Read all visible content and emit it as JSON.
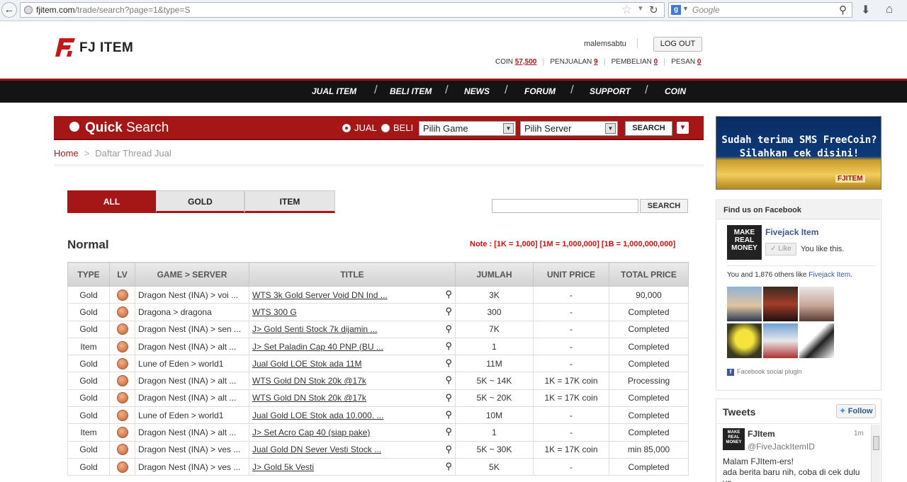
{
  "browser": {
    "url_domain": "fjitem.com",
    "url_path": "/trade/search?page=1&type=S",
    "search_placeholder": "Google"
  },
  "site": {
    "logo_text": "FJ ITEM",
    "username": "malemsabtu",
    "logout_label": "LOG OUT",
    "stats": {
      "coin_label": "COIN",
      "coin_value": "57,500",
      "penjualan_label": "PENJUALAN",
      "penjualan_value": "9",
      "pembelian_label": "PEMBELIAN",
      "pembelian_value": "0",
      "pesan_label": "PESAN",
      "pesan_value": "0"
    },
    "nav": [
      "JUAL ITEM",
      "BELI ITEM",
      "NEWS",
      "FORUM",
      "SUPPORT",
      "COIN"
    ]
  },
  "quick_search": {
    "title_bold": "Quick",
    "title_rest": " Search",
    "radio_jual": "JUAL",
    "radio_beli": "BELI",
    "selected_radio": "JUAL",
    "game_select": "Pilih Game",
    "server_select": "Pilih Server",
    "search_label": "SEARCH"
  },
  "breadcrumb": {
    "home": "Home",
    "separator": ">",
    "current": "Daftar Thread Jual"
  },
  "tabs": [
    {
      "label": "ALL",
      "active": true
    },
    {
      "label": "GOLD",
      "active": false
    },
    {
      "label": "ITEM",
      "active": false
    }
  ],
  "table_search": {
    "value": "",
    "button": "SEARCH"
  },
  "section_title": "Normal",
  "note": "Note : [1K = 1,000] [1M = 1,000,000] [1B = 1,000,000,000]",
  "table": {
    "headers": [
      "TYPE",
      "LV",
      "GAME > SERVER",
      "TITLE",
      "JUMLAH",
      "UNIT PRICE",
      "TOTAL PRICE"
    ],
    "rows": [
      {
        "type": "Gold",
        "game": "Dragon Nest (INA) > voi ...",
        "title": "WTS 3k Gold Server Void DN Ind ...",
        "jumlah": "3K",
        "unit": "-",
        "total": "90,000"
      },
      {
        "type": "Gold",
        "game": "Dragona > dragona",
        "title": "WTS 300 G",
        "jumlah": "300",
        "unit": "-",
        "total": "Completed"
      },
      {
        "type": "Gold",
        "game": "Dragon Nest (INA) > sen ...",
        "title": "J> Gold Senti Stock 7k dijamin ...",
        "jumlah": "7K",
        "unit": "-",
        "total": "Completed"
      },
      {
        "type": "Item",
        "game": "Dragon Nest (INA) > alt ...",
        "title": "J> Set Paladin Cap 40 PNP (BU ...",
        "jumlah": "1",
        "unit": "-",
        "total": "Completed"
      },
      {
        "type": "Gold",
        "game": "Lune of Eden > world1",
        "title": "Jual Gold LOE Stok ada 11M",
        "jumlah": "11M",
        "unit": "-",
        "total": "Completed"
      },
      {
        "type": "Gold",
        "game": "Dragon Nest (INA) > alt ...",
        "title": "WTS Gold DN Stok 20k @17k",
        "jumlah": "5K ~ 14K",
        "unit": "1K = 17K coin",
        "total": "Processing"
      },
      {
        "type": "Gold",
        "game": "Dragon Nest (INA) > alt ...",
        "title": "WTS Gold DN Stok 20k @17k",
        "jumlah": "5K ~ 20K",
        "unit": "1K = 17K coin",
        "total": "Completed"
      },
      {
        "type": "Gold",
        "game": "Lune of Eden > world1",
        "title": "Jual Gold LOE Stok ada 10.000. ...",
        "jumlah": "10M",
        "unit": "-",
        "total": "Completed"
      },
      {
        "type": "Item",
        "game": "Dragon Nest (INA) > alt ...",
        "title": "J> Set Acro Cap 40 (siap pake)",
        "jumlah": "1",
        "unit": "-",
        "total": "Completed"
      },
      {
        "type": "Gold",
        "game": "Dragon Nest (INA) > ves ...",
        "title": "Jual Gold DN Sever Vesti Stock ...",
        "jumlah": "5K ~ 30K",
        "unit": "1K = 17K coin",
        "total": "min 85,000"
      },
      {
        "type": "Gold",
        "game": "Dragon Nest (INA) > ves ...",
        "title": "J> Gold 5k Vesti",
        "jumlah": "5K",
        "unit": "-",
        "total": "Completed"
      }
    ]
  },
  "banner": {
    "line1": "Sudah terima SMS FreeCoin?",
    "line2": "Silahkan cek disini!",
    "logo": "FJITEM"
  },
  "facebook": {
    "header": "Find us on Facebook",
    "page_name": "Fivejack Item",
    "page_pic_text": "MAKE REAL MONEY",
    "like_label": "Like",
    "you_like": "You like this.",
    "others_prefix": "You and 1,876 others like ",
    "others_link": "Fivejack Item",
    "others_suffix": ".",
    "plugin": "Facebook social plugin"
  },
  "tweets": {
    "title": "Tweets",
    "follow": "Follow",
    "name": "FJItem",
    "handle": "@FiveJackItemID",
    "time": "1m",
    "body": "Malam FJItem-ers!\nada berita baru nih, coba di cek dulu ya"
  }
}
